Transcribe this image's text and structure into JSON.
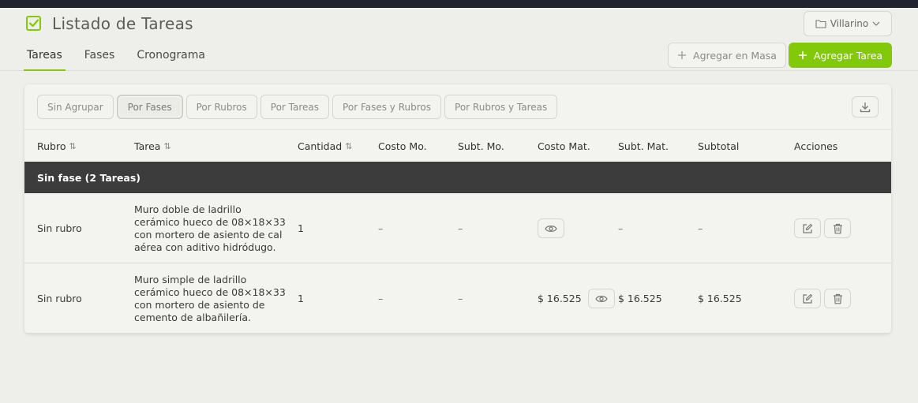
{
  "header": {
    "title": "Listado de Tareas",
    "project": "Villarino"
  },
  "tabs": [
    {
      "label": "Tareas",
      "active": true
    },
    {
      "label": "Fases",
      "active": false
    },
    {
      "label": "Cronograma",
      "active": false
    }
  ],
  "toolbar": {
    "mass_add_label": "Agregar en Masa",
    "add_label": "Agregar Tarea"
  },
  "grouping": [
    {
      "label": "Sin Agrupar",
      "active": false
    },
    {
      "label": "Por Fases",
      "active": true
    },
    {
      "label": "Por Rubros",
      "active": false
    },
    {
      "label": "Por Tareas",
      "active": false
    },
    {
      "label": "Por Fases y Rubros",
      "active": false
    },
    {
      "label": "Por Rubros y Tareas",
      "active": false
    }
  ],
  "table": {
    "columns": [
      "Rubro",
      "Tarea",
      "Cantidad",
      "Costo Mo.",
      "Subt. Mo.",
      "Costo Mat.",
      "Subt. Mat.",
      "Subtotal",
      "Acciones"
    ],
    "group_label": "Sin fase (2 Tareas)",
    "rows": [
      {
        "rubro": "Sin rubro",
        "tarea": "Muro doble de ladrillo cerámico hueco de 08×18×33 con mortero de asiento de cal aérea con aditivo hidródugo.",
        "cantidad": "1",
        "costo_mo": "–",
        "subt_mo": "–",
        "costo_mat": "",
        "subt_mat": "–",
        "subtotal": "–"
      },
      {
        "rubro": "Sin rubro",
        "tarea": "Muro simple de ladrillo cerámico hueco de 08×18×33 con mortero de asiento de cemento de albañilería.",
        "cantidad": "1",
        "costo_mo": "–",
        "subt_mo": "–",
        "costo_mat": "$ 16.525",
        "subt_mat": "$ 16.525",
        "subtotal": "$ 16.525"
      }
    ]
  },
  "colors": {
    "accent": "#82c909",
    "group_row": "#3c3c3c",
    "background": "#eeeeea"
  }
}
